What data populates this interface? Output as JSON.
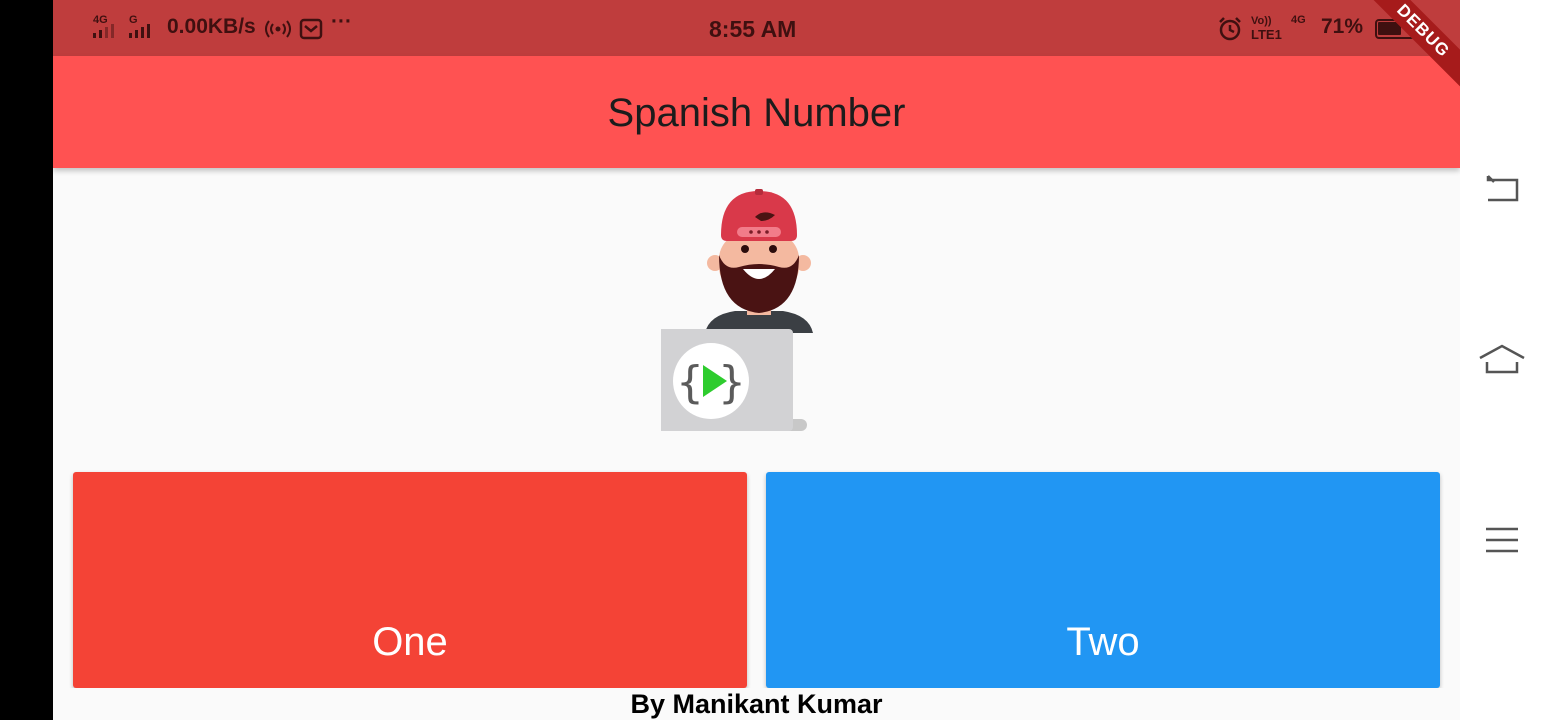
{
  "status_bar": {
    "network_1": "4G",
    "network_2": "G",
    "speed": "0.00KB/s",
    "more": "···",
    "time": "8:55 AM",
    "volte": "Vo))",
    "lte": "LTE1",
    "network_3": "4G",
    "battery": "71%",
    "battery_level": 0.71
  },
  "debug_banner": "DEBUG",
  "app_bar": {
    "title": "Spanish Number"
  },
  "buttons": [
    {
      "label": "One",
      "color": "#f44336"
    },
    {
      "label": "Two",
      "color": "#2196f3"
    }
  ],
  "footer": {
    "text": "By Manikant Kumar"
  },
  "colors": {
    "status_bar": "#bf3d3d",
    "app_bar": "#ff5252",
    "background": "#fafafa"
  },
  "nav_icons": [
    "back-icon",
    "home-icon",
    "menu-icon"
  ]
}
